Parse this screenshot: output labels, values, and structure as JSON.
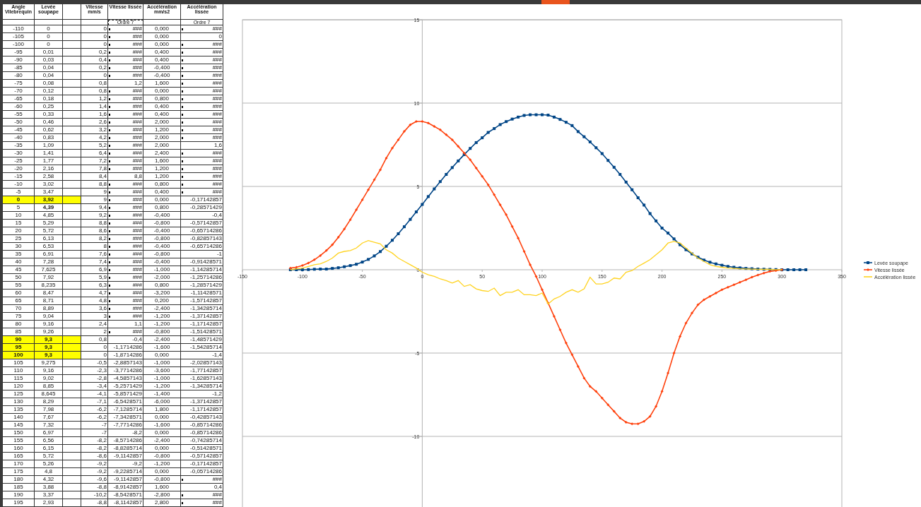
{
  "table": {
    "columns": [
      "Angle Vilebrequin",
      "Levée soupape",
      "Vitesse mm/s",
      "Vitesse lissée",
      "Accélération mm/s2",
      "Accélération lissée"
    ],
    "order_labels": [
      "Ordre 7",
      "Ordre 7"
    ],
    "rows": [
      {
        "cells": [
          "-110",
          "0",
          "0",
          "###",
          "0,000",
          "###"
        ],
        "highlighted": false,
        "bold": false,
        "flag_e": true,
        "flag_g": true
      },
      {
        "cells": [
          "-105",
          "0",
          "0",
          "###",
          "0,000",
          "0"
        ],
        "highlighted": false,
        "bold": false,
        "flag_e": true,
        "flag_g": false
      },
      {
        "cells": [
          "-100",
          "0",
          "0",
          "###",
          "0,000",
          "###"
        ],
        "highlighted": false,
        "bold": false,
        "flag_e": true,
        "flag_g": true
      },
      {
        "cells": [
          "-95",
          "0,01",
          "0,2",
          "###",
          "0,400",
          "###"
        ],
        "highlighted": false,
        "bold": false,
        "flag_e": true,
        "flag_g": true
      },
      {
        "cells": [
          "-90",
          "0,03",
          "0,4",
          "###",
          "0,400",
          "###"
        ],
        "highlighted": false,
        "bold": false,
        "flag_e": true,
        "flag_g": true
      },
      {
        "cells": [
          "-85",
          "0,04",
          "0,2",
          "###",
          "-0,400",
          "###"
        ],
        "highlighted": false,
        "bold": false,
        "flag_e": true,
        "flag_g": true
      },
      {
        "cells": [
          "-80",
          "0,04",
          "0",
          "###",
          "-0,400",
          "###"
        ],
        "highlighted": false,
        "bold": false,
        "flag_e": true,
        "flag_g": true
      },
      {
        "cells": [
          "-75",
          "0,08",
          "0,8",
          "1,2",
          "1,600",
          "###"
        ],
        "highlighted": false,
        "bold": false,
        "flag_e": false,
        "flag_g": true
      },
      {
        "cells": [
          "-70",
          "0,12",
          "0,8",
          "###",
          "0,000",
          "###"
        ],
        "highlighted": false,
        "bold": false,
        "flag_e": true,
        "flag_g": true
      },
      {
        "cells": [
          "-65",
          "0,18",
          "1,2",
          "###",
          "0,800",
          "###"
        ],
        "highlighted": false,
        "bold": false,
        "flag_e": true,
        "flag_g": true
      },
      {
        "cells": [
          "-60",
          "0,25",
          "1,4",
          "###",
          "0,400",
          "###"
        ],
        "highlighted": false,
        "bold": false,
        "flag_e": true,
        "flag_g": true
      },
      {
        "cells": [
          "-55",
          "0,33",
          "1,6",
          "###",
          "0,400",
          "###"
        ],
        "highlighted": false,
        "bold": false,
        "flag_e": true,
        "flag_g": true
      },
      {
        "cells": [
          "-50",
          "0,46",
          "2,6",
          "###",
          "2,000",
          "###"
        ],
        "highlighted": false,
        "bold": false,
        "flag_e": true,
        "flag_g": true
      },
      {
        "cells": [
          "-45",
          "0,62",
          "3,2",
          "###",
          "1,200",
          "###"
        ],
        "highlighted": false,
        "bold": false,
        "flag_e": true,
        "flag_g": true
      },
      {
        "cells": [
          "-40",
          "0,83",
          "4,2",
          "###",
          "2,000",
          "###"
        ],
        "highlighted": false,
        "bold": false,
        "flag_e": true,
        "flag_g": true
      },
      {
        "cells": [
          "-35",
          "1,09",
          "5,2",
          "###",
          "2,000",
          "1,6"
        ],
        "highlighted": false,
        "bold": false,
        "flag_e": true,
        "flag_g": false
      },
      {
        "cells": [
          "-30",
          "1,41",
          "6,4",
          "###",
          "2,400",
          "###"
        ],
        "highlighted": false,
        "bold": false,
        "flag_e": true,
        "flag_g": true
      },
      {
        "cells": [
          "-25",
          "1,77",
          "7,2",
          "###",
          "1,600",
          "###"
        ],
        "highlighted": false,
        "bold": false,
        "flag_e": true,
        "flag_g": true
      },
      {
        "cells": [
          "-20",
          "2,16",
          "7,8",
          "###",
          "1,200",
          "###"
        ],
        "highlighted": false,
        "bold": false,
        "flag_e": true,
        "flag_g": true
      },
      {
        "cells": [
          "-15",
          "2,58",
          "8,4",
          "8,8",
          "1,200",
          "###"
        ],
        "highlighted": false,
        "bold": false,
        "flag_e": false,
        "flag_g": true
      },
      {
        "cells": [
          "-10",
          "3,02",
          "8,8",
          "###",
          "0,800",
          "###"
        ],
        "highlighted": false,
        "bold": false,
        "flag_e": true,
        "flag_g": true
      },
      {
        "cells": [
          "-5",
          "3,47",
          "9",
          "###",
          "0,400",
          "###"
        ],
        "highlighted": false,
        "bold": false,
        "flag_e": true,
        "flag_g": true
      },
      {
        "cells": [
          "0",
          "3,92",
          "9",
          "###",
          "0,000",
          "-0,17142857"
        ],
        "highlighted": true,
        "bold": true,
        "flag_e": true,
        "flag_g": false
      },
      {
        "cells": [
          "5",
          "4,39",
          "9,4",
          "###",
          "0,800",
          "-0,28571429"
        ],
        "highlighted": false,
        "bold": true,
        "flag_e": true,
        "flag_g": false
      },
      {
        "cells": [
          "10",
          "4,85",
          "9,2",
          "###",
          "-0,400",
          "-0,4"
        ],
        "highlighted": false,
        "bold": false,
        "flag_e": true,
        "flag_g": false
      },
      {
        "cells": [
          "15",
          "5,29",
          "8,8",
          "###",
          "-0,800",
          "-0,57142857"
        ],
        "highlighted": false,
        "bold": false,
        "flag_e": true,
        "flag_g": false
      },
      {
        "cells": [
          "20",
          "5,72",
          "8,6",
          "###",
          "-0,400",
          "-0,65714286"
        ],
        "highlighted": false,
        "bold": false,
        "flag_e": true,
        "flag_g": false
      },
      {
        "cells": [
          "25",
          "6,13",
          "8,2",
          "###",
          "-0,800",
          "-0,82857143"
        ],
        "highlighted": false,
        "bold": false,
        "flag_e": true,
        "flag_g": false
      },
      {
        "cells": [
          "30",
          "6,53",
          "8",
          "###",
          "-0,400",
          "-0,65714286"
        ],
        "highlighted": false,
        "bold": false,
        "flag_e": true,
        "flag_g": false
      },
      {
        "cells": [
          "35",
          "6,91",
          "7,6",
          "###",
          "-0,800",
          "-1"
        ],
        "highlighted": false,
        "bold": false,
        "flag_e": true,
        "flag_g": false
      },
      {
        "cells": [
          "40",
          "7,28",
          "7,4",
          "###",
          "-0,400",
          "-0,91428571"
        ],
        "highlighted": false,
        "bold": false,
        "flag_e": true,
        "flag_g": false
      },
      {
        "cells": [
          "45",
          "7,625",
          "6,9",
          "###",
          "-1,000",
          "-1,14285714"
        ],
        "highlighted": false,
        "bold": false,
        "flag_e": true,
        "flag_g": false
      },
      {
        "cells": [
          "50",
          "7,92",
          "5,9",
          "###",
          "-2,000",
          "-1,25714286"
        ],
        "highlighted": false,
        "bold": false,
        "flag_e": true,
        "flag_g": false
      },
      {
        "cells": [
          "55",
          "8,235",
          "6,3",
          "###",
          "0,800",
          "-1,28571429"
        ],
        "highlighted": false,
        "bold": false,
        "flag_e": true,
        "flag_g": false
      },
      {
        "cells": [
          "60",
          "8,47",
          "4,7",
          "###",
          "-3,200",
          "-1,11428571"
        ],
        "highlighted": false,
        "bold": false,
        "flag_e": true,
        "flag_g": false
      },
      {
        "cells": [
          "65",
          "8,71",
          "4,8",
          "###",
          "0,200",
          "-1,57142857"
        ],
        "highlighted": false,
        "bold": false,
        "flag_e": true,
        "flag_g": false
      },
      {
        "cells": [
          "70",
          "8,89",
          "3,6",
          "###",
          "-2,400",
          "-1,34285714"
        ],
        "highlighted": false,
        "bold": false,
        "flag_e": true,
        "flag_g": false
      },
      {
        "cells": [
          "75",
          "9,04",
          "3",
          "###",
          "-1,200",
          "-1,37142857"
        ],
        "highlighted": false,
        "bold": false,
        "flag_e": true,
        "flag_g": false
      },
      {
        "cells": [
          "80",
          "9,16",
          "2,4",
          "1,1",
          "-1,200",
          "-1,17142857"
        ],
        "highlighted": false,
        "bold": false,
        "flag_e": false,
        "flag_g": false
      },
      {
        "cells": [
          "85",
          "9,26",
          "2",
          "###",
          "-0,800",
          "-1,51428571"
        ],
        "highlighted": false,
        "bold": false,
        "flag_e": true,
        "flag_g": false
      },
      {
        "cells": [
          "90",
          "9,3",
          "0,8",
          "-0,4",
          "-2,400",
          "-1,48571429"
        ],
        "highlighted": true,
        "bold": true,
        "flag_e": false,
        "flag_g": false
      },
      {
        "cells": [
          "95",
          "9,3",
          "0",
          "-1,1714286",
          "-1,600",
          "-1,54285714"
        ],
        "highlighted": true,
        "bold": true,
        "flag_e": false,
        "flag_g": false
      },
      {
        "cells": [
          "100",
          "9,3",
          "0",
          "-1,8714286",
          "0,000",
          "-1,4"
        ],
        "highlighted": true,
        "bold": true,
        "flag_e": false,
        "flag_g": false
      },
      {
        "cells": [
          "105",
          "9,275",
          "-0,5",
          "-2,8857143",
          "-1,000",
          "-2,02857143"
        ],
        "highlighted": false,
        "bold": false,
        "flag_e": false,
        "flag_g": false
      },
      {
        "cells": [
          "110",
          "9,16",
          "-2,3",
          "-3,7714286",
          "-3,600",
          "-1,77142857"
        ],
        "highlighted": false,
        "bold": false,
        "flag_e": false,
        "flag_g": false
      },
      {
        "cells": [
          "115",
          "9,02",
          "-2,8",
          "-4,5857143",
          "-1,000",
          "-1,62857143"
        ],
        "highlighted": false,
        "bold": false,
        "flag_e": false,
        "flag_g": false
      },
      {
        "cells": [
          "120",
          "8,85",
          "-3,4",
          "-5,2571429",
          "-1,200",
          "-1,34285714"
        ],
        "highlighted": false,
        "bold": false,
        "flag_e": false,
        "flag_g": false
      },
      {
        "cells": [
          "125",
          "8,645",
          "-4,1",
          "-5,8571429",
          "-1,400",
          "-1,2"
        ],
        "highlighted": false,
        "bold": false,
        "flag_e": false,
        "flag_g": false
      },
      {
        "cells": [
          "130",
          "8,29",
          "-7,1",
          "-6,5428571",
          "-6,000",
          "-1,37142857"
        ],
        "highlighted": false,
        "bold": false,
        "flag_e": false,
        "flag_g": false
      },
      {
        "cells": [
          "135",
          "7,98",
          "-6,2",
          "-7,1285714",
          "1,800",
          "-1,17142857"
        ],
        "highlighted": false,
        "bold": false,
        "flag_e": false,
        "flag_g": false
      },
      {
        "cells": [
          "140",
          "7,67",
          "-6,2",
          "-7,3428571",
          "0,000",
          "-0,42857143"
        ],
        "highlighted": false,
        "bold": false,
        "flag_e": false,
        "flag_g": false
      },
      {
        "cells": [
          "145",
          "7,32",
          "-7",
          "-7,7714286",
          "-1,600",
          "-0,85714286"
        ],
        "highlighted": false,
        "bold": false,
        "flag_e": false,
        "flag_g": false
      },
      {
        "cells": [
          "150",
          "6,97",
          "-7",
          "-8,2",
          "0,000",
          "-0,85714286"
        ],
        "highlighted": false,
        "bold": false,
        "flag_e": false,
        "flag_g": false
      },
      {
        "cells": [
          "155",
          "6,56",
          "-8,2",
          "-8,5714286",
          "-2,400",
          "-0,74285714"
        ],
        "highlighted": false,
        "bold": false,
        "flag_e": false,
        "flag_g": false
      },
      {
        "cells": [
          "160",
          "6,15",
          "-8,2",
          "-8,8285714",
          "0,000",
          "-0,51428571"
        ],
        "highlighted": false,
        "bold": false,
        "flag_e": false,
        "flag_g": false
      },
      {
        "cells": [
          "165",
          "5,72",
          "-8,6",
          "-9,1142857",
          "-0,800",
          "-0,57142857"
        ],
        "highlighted": false,
        "bold": false,
        "flag_e": false,
        "flag_g": false
      },
      {
        "cells": [
          "170",
          "5,26",
          "-9,2",
          "-9,2",
          "-1,200",
          "-0,17142857"
        ],
        "highlighted": false,
        "bold": false,
        "flag_e": false,
        "flag_g": false
      },
      {
        "cells": [
          "175",
          "4,8",
          "-9,2",
          "-9,2285714",
          "0,000",
          "-0,05714286"
        ],
        "highlighted": false,
        "bold": false,
        "flag_e": false,
        "flag_g": false
      },
      {
        "cells": [
          "180",
          "4,32",
          "-9,6",
          "-9,1142857",
          "-0,800",
          "###"
        ],
        "highlighted": false,
        "bold": false,
        "flag_e": false,
        "flag_g": true
      },
      {
        "cells": [
          "185",
          "3,88",
          "-8,8",
          "-8,9142857",
          "1,600",
          "0,4"
        ],
        "highlighted": false,
        "bold": false,
        "flag_e": false,
        "flag_g": false
      },
      {
        "cells": [
          "190",
          "3,37",
          "-10,2",
          "-8,5428571",
          "-2,800",
          "###"
        ],
        "highlighted": false,
        "bold": false,
        "flag_e": false,
        "flag_g": true
      },
      {
        "cells": [
          "195",
          "2,93",
          "-8,8",
          "-8,1142857",
          "2,800",
          "###"
        ],
        "highlighted": false,
        "bold": false,
        "flag_e": false,
        "flag_g": true
      }
    ]
  },
  "chart": {
    "chart_data": {
      "type": "line",
      "grid": true,
      "legend": true,
      "xlim": [
        -150,
        350
      ],
      "ylim": [
        -15,
        15
      ],
      "xticks": [
        {
          "value": -150,
          "label": "-150"
        },
        {
          "value": -100,
          "label": "-100"
        },
        {
          "value": -50,
          "label": "-50"
        },
        {
          "value": 0,
          "label": "0"
        },
        {
          "value": 50,
          "label": "50"
        },
        {
          "value": 100,
          "label": "100"
        },
        {
          "value": 150,
          "label": "150"
        },
        {
          "value": 200,
          "label": "200"
        },
        {
          "value": 250,
          "label": "250"
        },
        {
          "value": 300,
          "label": "300"
        },
        {
          "value": 350,
          "label": "350"
        }
      ],
      "yticks": [
        {
          "value": -10,
          "label": "-10"
        },
        {
          "value": -5,
          "label": "-5"
        },
        {
          "value": 0,
          "label": "0"
        },
        {
          "value": 5,
          "label": "5"
        },
        {
          "value": 10,
          "label": "10"
        },
        {
          "value": 15,
          "label": "15"
        }
      ],
      "x": [
        -110,
        -105,
        -100,
        -95,
        -90,
        -85,
        -80,
        -75,
        -70,
        -65,
        -60,
        -55,
        -50,
        -45,
        -40,
        -35,
        -30,
        -25,
        -20,
        -15,
        -10,
        -5,
        0,
        5,
        10,
        15,
        20,
        25,
        30,
        35,
        40,
        45,
        50,
        55,
        60,
        65,
        70,
        75,
        80,
        85,
        90,
        95,
        100,
        105,
        110,
        115,
        120,
        125,
        130,
        135,
        140,
        145,
        150,
        155,
        160,
        165,
        170,
        175,
        180,
        185,
        190,
        195,
        200,
        205,
        210,
        215,
        220,
        225,
        230,
        235,
        240,
        245,
        250,
        255,
        260,
        265,
        270,
        275,
        280,
        285,
        290,
        295,
        300,
        305,
        310,
        315,
        320
      ],
      "series": [
        {
          "name": "Levée soupape",
          "color": "#004586",
          "marker": "square",
          "values": [
            0,
            0,
            0,
            0.01,
            0.03,
            0.04,
            0.04,
            0.08,
            0.12,
            0.18,
            0.25,
            0.33,
            0.46,
            0.62,
            0.83,
            1.09,
            1.41,
            1.77,
            2.16,
            2.58,
            3.02,
            3.47,
            3.92,
            4.39,
            4.85,
            5.29,
            5.72,
            6.13,
            6.53,
            6.91,
            7.28,
            7.63,
            7.92,
            8.24,
            8.47,
            8.71,
            8.89,
            9.04,
            9.16,
            9.26,
            9.3,
            9.3,
            9.3,
            9.28,
            9.16,
            9.02,
            8.85,
            8.65,
            8.29,
            7.98,
            7.67,
            7.32,
            6.97,
            6.56,
            6.15,
            5.72,
            5.26,
            4.8,
            4.32,
            3.88,
            3.37,
            2.93,
            2.5,
            2.2,
            1.85,
            1.5,
            1.2,
            0.95,
            0.75,
            0.58,
            0.45,
            0.35,
            0.27,
            0.2,
            0.15,
            0.11,
            0.08,
            0.06,
            0.04,
            0.03,
            0.02,
            0.01,
            0,
            0,
            0,
            0,
            0
          ]
        },
        {
          "name": "Vitesse lissée",
          "color": "#ff420e",
          "marker": "diamond",
          "values": [
            0.1,
            0.15,
            0.25,
            0.4,
            0.6,
            0.85,
            1.15,
            1.5,
            1.95,
            2.45,
            3.0,
            3.6,
            4.2,
            4.8,
            5.4,
            6.0,
            6.7,
            7.3,
            7.8,
            8.3,
            8.7,
            8.9,
            8.9,
            8.8,
            8.6,
            8.4,
            8.1,
            7.8,
            7.4,
            7.0,
            6.6,
            6.1,
            5.6,
            5.1,
            4.5,
            3.9,
            3.3,
            2.6,
            1.9,
            1.1,
            0.3,
            -0.4,
            -1.2,
            -2.0,
            -2.8,
            -3.6,
            -4.4,
            -5.1,
            -5.8,
            -6.5,
            -7.0,
            -7.3,
            -7.7,
            -8.1,
            -8.5,
            -8.9,
            -9.15,
            -9.25,
            -9.25,
            -9.1,
            -8.8,
            -8.2,
            -7.3,
            -6.2,
            -5.0,
            -4.0,
            -3.2,
            -2.6,
            -2.1,
            -1.8,
            -1.6,
            -1.4,
            -1.2,
            -1.05,
            -0.9,
            -0.75,
            -0.6,
            -0.45,
            -0.32,
            -0.2,
            -0.1,
            -0.05,
            0,
            null,
            null,
            null,
            null
          ]
        },
        {
          "name": "Accélération lissée",
          "color": "#ffd320",
          "values": [
            0,
            0.05,
            0.1,
            0.2,
            0.3,
            0.35,
            0.5,
            0.7,
            1.0,
            1.1,
            1.15,
            1.3,
            1.6,
            1.75,
            1.65,
            1.55,
            1.2,
            1.0,
            0.7,
            0.5,
            0.3,
            0.1,
            -0.15,
            -0.3,
            -0.4,
            -0.55,
            -0.65,
            -0.8,
            -0.65,
            -1.0,
            -0.9,
            -1.15,
            -1.25,
            -1.3,
            -1.1,
            -1.55,
            -1.35,
            -1.35,
            -1.2,
            -1.5,
            -1.5,
            -1.55,
            -1.4,
            -2.05,
            -1.75,
            -1.6,
            -1.35,
            -1.2,
            -1.35,
            -1.15,
            -0.45,
            -0.85,
            -0.85,
            -0.75,
            -0.5,
            -0.55,
            -0.15,
            -0.05,
            0.2,
            0.4,
            0.6,
            0.9,
            1.2,
            1.6,
            1.7,
            1.6,
            1.3,
            1.0,
            0.7,
            0.5,
            0.3,
            0.2,
            0.15,
            0.1,
            0.08,
            0.06,
            0.05,
            0.04,
            0.03,
            0.02,
            0.02,
            0.01,
            0.01,
            null,
            null,
            null,
            null
          ]
        }
      ]
    }
  }
}
